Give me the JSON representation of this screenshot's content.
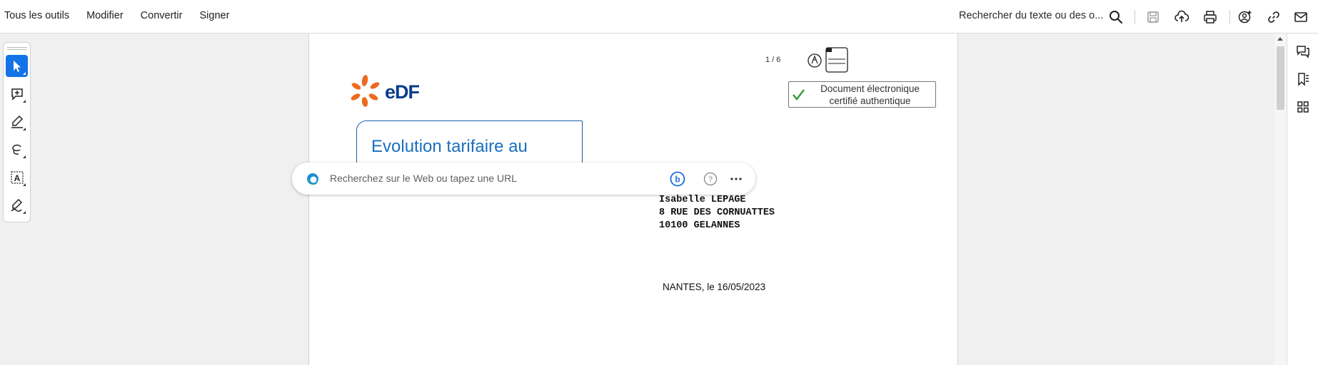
{
  "menu": {
    "items": [
      "Tous les outils",
      "Modifier",
      "Convertir",
      "Signer"
    ]
  },
  "toolbar": {
    "search_text": "Rechercher du texte ou des o...",
    "icons": [
      "search-icon",
      "save-icon",
      "upload-cloud-icon",
      "print-icon",
      "share-user-icon",
      "link-icon",
      "mail-icon"
    ]
  },
  "tools": [
    "select-cursor-icon",
    "add-comment-icon",
    "highlight-pen-icon",
    "freehand-lasso-icon",
    "text-recognition-icon",
    "sign-pen-icon"
  ],
  "document": {
    "page_indicator": "1 / 6",
    "logo_text": "eDF",
    "cert_line1": "Document électronique",
    "cert_line2": "certifié authentique",
    "title": "Evolution tarifaire au",
    "address_line1": "Isabelle LEPAGE",
    "address_line2": "8 RUE DES CORNUATTES",
    "address_line3": "10100 GELANNES",
    "date_line": "NANTES, le 16/05/2023"
  },
  "overlay": {
    "placeholder": "Recherchez sur le Web ou tapez une URL"
  },
  "colors": {
    "accent": "#1473e6",
    "edf_orange": "#ee6a1f",
    "edf_blue": "#0a3c8c",
    "title_blue": "#1a6fbf"
  }
}
